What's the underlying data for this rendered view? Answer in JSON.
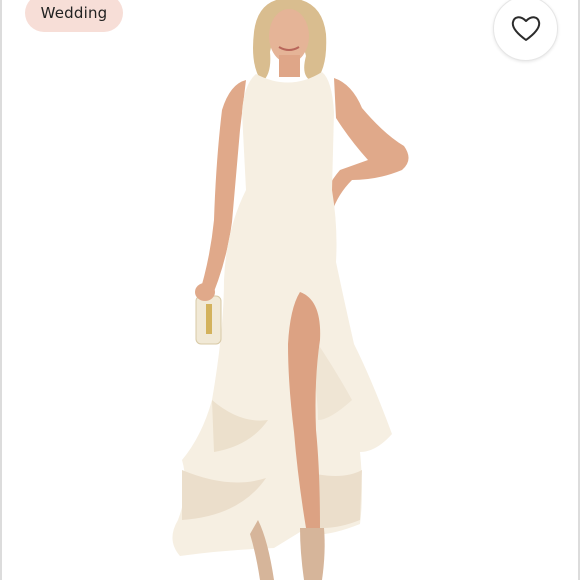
{
  "listing": {
    "tag_label": "Wedding",
    "photo_icon": "product-photo",
    "like_icon": "heart-icon"
  },
  "colors": {
    "tag_background": "#f7ded7",
    "tag_text": "#222222",
    "dress": "#f6efe2",
    "skin": "#e0a98a",
    "hair": "#d9bd8f",
    "heart_stroke": "#2b2b2b"
  }
}
